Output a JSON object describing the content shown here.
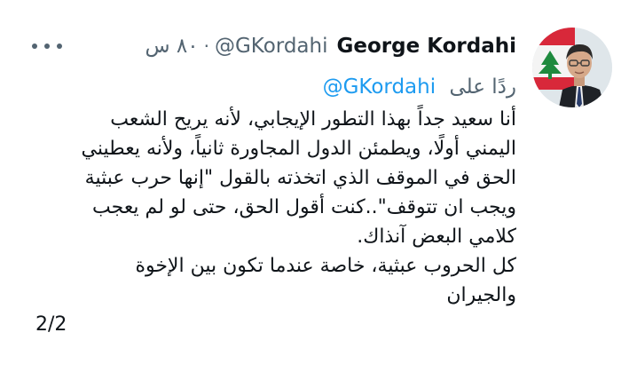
{
  "tweet": {
    "author": {
      "name": "George Kordahi",
      "handle": "@GKordahi",
      "avatar_icon": "profile-photo-with-cedar-flag"
    },
    "separator": "·",
    "time": "٨٠ س",
    "reply_prefix": "ردًا على",
    "reply_to": "@GKordahi",
    "lines": [
      "أنا سعيد جداً بهذا التطور الإيجابي، لأنه يريح الشعب",
      "اليمني أولًا، ويطمئن الدول المجاورة ثانياً، ولأنه يعطيني",
      "الحق في الموقف الذي اتخذته بالقول \"إنها حرب عبثية",
      "ويجب ان تتوقف\"..كنت أقول الحق، حتى لو لم يعجب",
      "كلامي البعض آنذاك.",
      "كل الحروب عبثية، خاصة عندما تكون بين الإخوة",
      "والجيران"
    ],
    "page_count": "2/2",
    "more_icon": "more-options-icon"
  },
  "colors": {
    "text": "#0f1419",
    "secondary": "#536471",
    "link": "#1d9bf0",
    "background": "#ffffff"
  }
}
